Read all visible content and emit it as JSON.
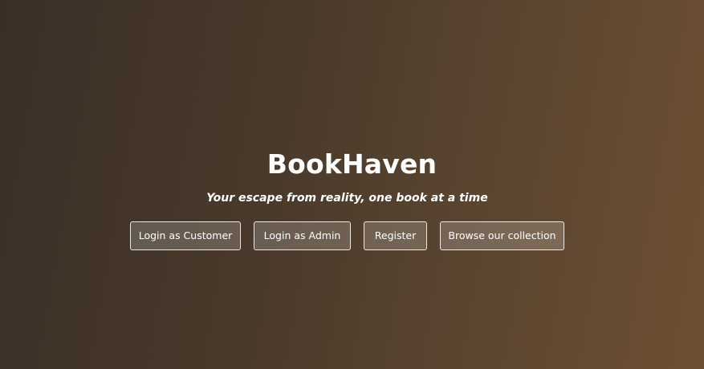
{
  "hero": {
    "title": "BookHaven",
    "tagline": "Your escape from reality, one book at a time"
  },
  "actions": {
    "customer_login": "Login as Customer",
    "admin_login": "Login as Admin",
    "register": "Register",
    "browse": "Browse our collection"
  },
  "colors": {
    "background_start": "#3a2f27",
    "background_end": "#6d5032",
    "text": "#ffffff"
  }
}
